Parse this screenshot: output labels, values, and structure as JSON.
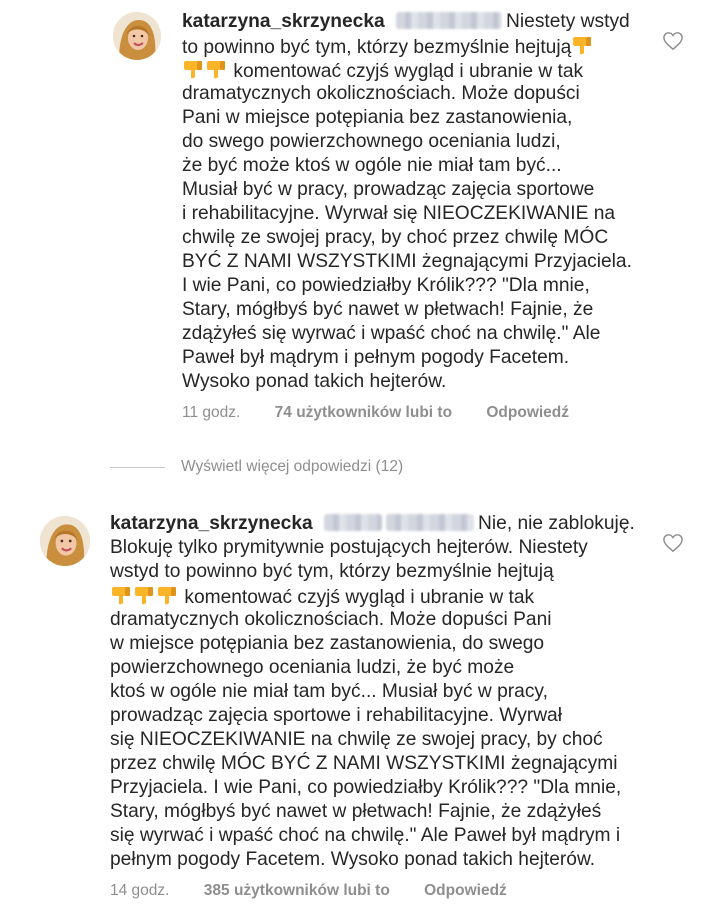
{
  "comments": [
    {
      "username": "katarzyna_skrzynecka",
      "lines": [
        "Niestety wstyd",
        "to powinno być tym, którzy bezmyślnie hejtują",
        "komentować czyjś wygląd i ubranie w tak",
        "dramatycznych okolicznościach. Może dopuści",
        "Pani w miejsce potępiania bez zastanowienia,",
        "do swego powierzchownego oceniania ludzi,",
        "że być może  ktoś w ogóle nie miał tam być...",
        "Musiał być w pracy, prowadząc zajęcia sportowe",
        "i rehabilitacyjne. Wyrwał się NIEOCZEKIWANIE na",
        "chwilę ze swojej pracy, by choć przez chwilę MÓC",
        "BYĆ Z NAMI WSZYSTKIMI żegnającymi Przyjaciela.",
        "I wie Pani, co powiedziałby Królik??? \"Dla mnie,",
        "Stary, mógłbyś być nawet w płetwach! Fajnie, że",
        "zdążyłeś się wyrwać i wpaść choć na chwilę.\" Ale",
        "Paweł był mądrym i pełnym pogody Facetem.",
        "Wysoko ponad takich hejterów."
      ],
      "time": "11 godz.",
      "likes": "74 użytkowników lubi to",
      "reply": "Odpowiedź"
    },
    {
      "username": "katarzyna_skrzynecka",
      "lines": [
        "Nie, nie zablokuję.",
        "Blokuję tylko prymitywnie postujących hejterów. Niestety",
        "wstyd to powinno być tym, którzy bezmyślnie hejtują",
        "komentować czyjś wygląd i ubranie w tak",
        "dramatycznych okolicznościach. Może dopuści Pani",
        "w miejsce potępiania bez zastanowienia, do swego",
        "powierzchownego oceniania ludzi, że być może",
        "ktoś w ogóle nie miał tam być... Musiał być w pracy,",
        "prowadząc zajęcia sportowe i rehabilitacyjne. Wyrwał",
        "się NIEOCZEKIWANIE na chwilę ze swojej pracy, by choć",
        "przez chwilę MÓC BYĆ Z NAMI WSZYSTKIMI żegnającymi",
        "Przyjaciela.  I wie Pani, co powiedziałby Królik??? \"Dla mnie,",
        "Stary, mógłbyś być nawet w płetwach! Fajnie, że zdążyłeś",
        "się wyrwać i wpaść choć na chwilę.\" Ale Paweł był mądrym i",
        "pełnym pogody Facetem. Wysoko ponad takich hejterów."
      ],
      "time": "14 godz.",
      "likes": "385 użytkowników lubi to",
      "reply": "Odpowiedź"
    }
  ],
  "view_more_replies": "Wyświetl więcej odpowiedzi (12)",
  "icons": {
    "like": "heart-outline-icon",
    "thumbs_down": "thumbs-down-emoji"
  },
  "colors": {
    "text": "#262626",
    "secondary": "#8e8e8e",
    "emoji": "#f9b427"
  }
}
